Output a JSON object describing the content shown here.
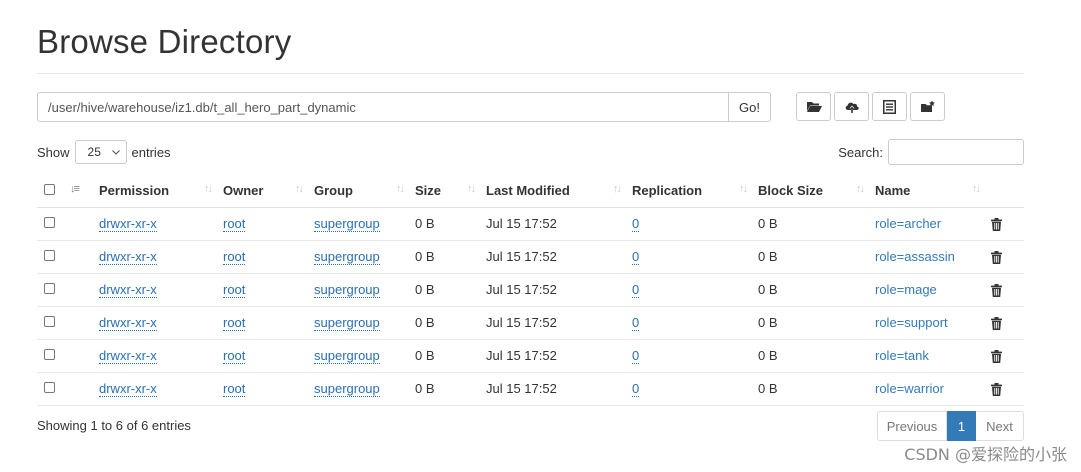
{
  "header": {
    "title": "Browse Directory"
  },
  "path_bar": {
    "value": "/user/hive/warehouse/iz1.db/t_all_hero_part_dynamic",
    "go_label": "Go!"
  },
  "toolbar": {
    "icons": [
      "folder-open-icon",
      "cloud-upload-icon",
      "list-icon",
      "new-folder-icon"
    ]
  },
  "length_control": {
    "show_label": "Show",
    "value": "25",
    "entries_label": "entries"
  },
  "search": {
    "label": "Search:",
    "value": ""
  },
  "table": {
    "columns": [
      "Permission",
      "Owner",
      "Group",
      "Size",
      "Last Modified",
      "Replication",
      "Block Size",
      "Name"
    ],
    "rows": [
      {
        "permission": "drwxr-xr-x",
        "owner": "root",
        "group": "supergroup",
        "size": "0 B",
        "modified": "Jul 15 17:52",
        "replication": "0",
        "block_size": "0 B",
        "name": "role=archer"
      },
      {
        "permission": "drwxr-xr-x",
        "owner": "root",
        "group": "supergroup",
        "size": "0 B",
        "modified": "Jul 15 17:52",
        "replication": "0",
        "block_size": "0 B",
        "name": "role=assassin"
      },
      {
        "permission": "drwxr-xr-x",
        "owner": "root",
        "group": "supergroup",
        "size": "0 B",
        "modified": "Jul 15 17:52",
        "replication": "0",
        "block_size": "0 B",
        "name": "role=mage"
      },
      {
        "permission": "drwxr-xr-x",
        "owner": "root",
        "group": "supergroup",
        "size": "0 B",
        "modified": "Jul 15 17:52",
        "replication": "0",
        "block_size": "0 B",
        "name": "role=support"
      },
      {
        "permission": "drwxr-xr-x",
        "owner": "root",
        "group": "supergroup",
        "size": "0 B",
        "modified": "Jul 15 17:52",
        "replication": "0",
        "block_size": "0 B",
        "name": "role=tank"
      },
      {
        "permission": "drwxr-xr-x",
        "owner": "root",
        "group": "supergroup",
        "size": "0 B",
        "modified": "Jul 15 17:52",
        "replication": "0",
        "block_size": "0 B",
        "name": "role=warrior"
      }
    ]
  },
  "footer": {
    "info": "Showing 1 to 6 of 6 entries",
    "previous_label": "Previous",
    "current_page": "1",
    "next_label": "Next"
  },
  "watermark": "CSDN @爱探险的小张",
  "colors": {
    "link": "#337ab7",
    "page_active": "#337ab7",
    "border": "#cccccc"
  }
}
